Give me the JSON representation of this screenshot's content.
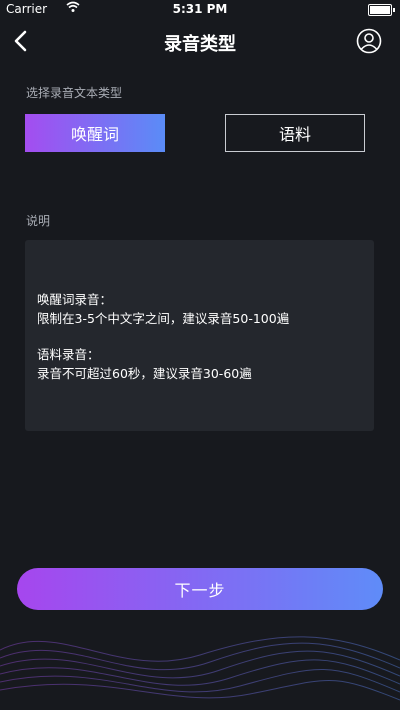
{
  "status_bar": {
    "carrier": "Carrier",
    "time": "5:31 PM"
  },
  "nav": {
    "title": "录音类型",
    "back_icon": "chevron-left-icon",
    "profile_icon": "user-circle-icon"
  },
  "type_section": {
    "label": "选择录音文本类型",
    "options": [
      {
        "label": "唤醒词",
        "selected": true
      },
      {
        "label": "语料",
        "selected": false
      }
    ]
  },
  "description": {
    "label": "说明",
    "wake_title": "唤醒词录音：",
    "wake_rule": "限制在3-5个中文字之间，建议录音50-100遍",
    "corpus_title": "语料录音：",
    "corpus_rule": "录音不可超过60秒，建议录音30-60遍"
  },
  "next_button": {
    "label": "下一步"
  },
  "colors": {
    "background": "#17191e",
    "gradient_start": "#a646ee",
    "gradient_end": "#5f8cf8",
    "panel": "#24272d"
  }
}
